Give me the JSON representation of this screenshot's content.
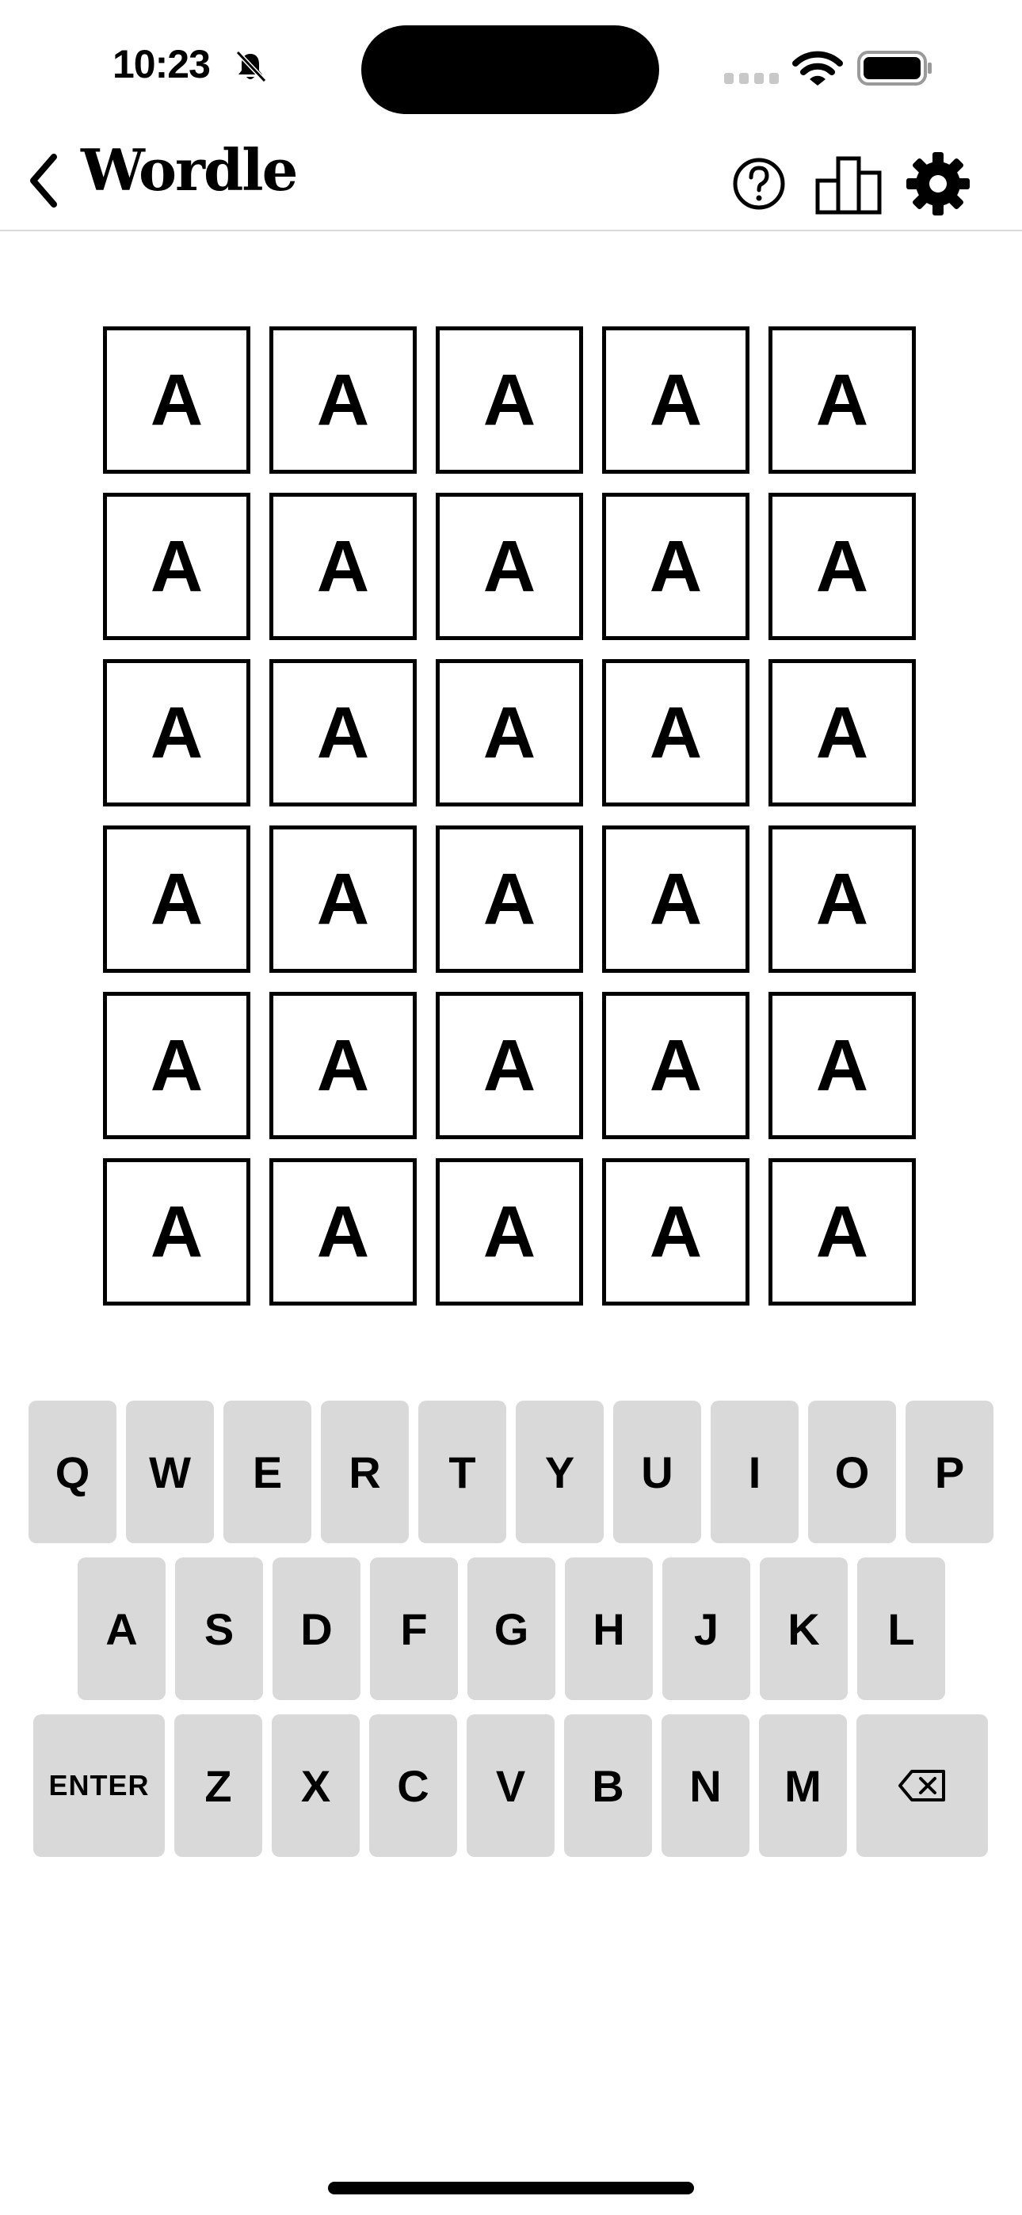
{
  "status_bar": {
    "time": "10:23",
    "icons": [
      "bell-slash-icon",
      "signal-icon",
      "wifi-icon",
      "battery-icon"
    ]
  },
  "nav": {
    "title": "Wordle",
    "icons": [
      "chevron-left-icon",
      "help-icon",
      "stats-icon",
      "gear-icon"
    ]
  },
  "board": {
    "rows": [
      [
        "A",
        "A",
        "A",
        "A",
        "A"
      ],
      [
        "A",
        "A",
        "A",
        "A",
        "A"
      ],
      [
        "A",
        "A",
        "A",
        "A",
        "A"
      ],
      [
        "A",
        "A",
        "A",
        "A",
        "A"
      ],
      [
        "A",
        "A",
        "A",
        "A",
        "A"
      ],
      [
        "A",
        "A",
        "A",
        "A",
        "A"
      ]
    ]
  },
  "keyboard": {
    "row1": [
      "Q",
      "W",
      "E",
      "R",
      "T",
      "Y",
      "U",
      "I",
      "O",
      "P"
    ],
    "row2": [
      "A",
      "S",
      "D",
      "F",
      "G",
      "H",
      "J",
      "K",
      "L"
    ],
    "row3": [
      "ENTER",
      "Z",
      "X",
      "C",
      "V",
      "B",
      "N",
      "M"
    ],
    "backspace_icon": "backspace-icon"
  },
  "colors": {
    "background": "#ffffff",
    "tile_border": "#000000",
    "key_background": "#d9d9d9",
    "divider": "#dadada"
  }
}
